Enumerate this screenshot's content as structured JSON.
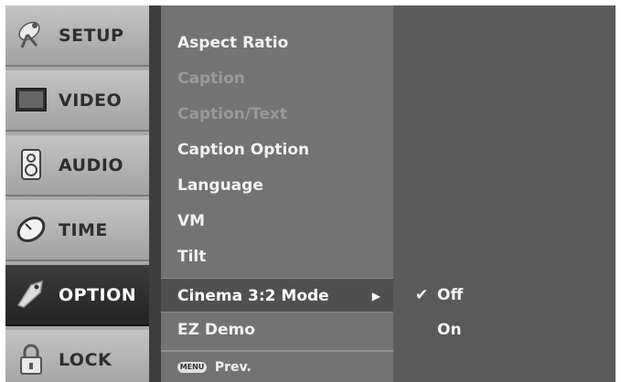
{
  "tabs": [
    {
      "label": "SETUP",
      "icon": "satellite-icon",
      "active": false
    },
    {
      "label": "VIDEO",
      "icon": "tv-icon",
      "active": false
    },
    {
      "label": "AUDIO",
      "icon": "speaker-icon",
      "active": false
    },
    {
      "label": "TIME",
      "icon": "clock-icon",
      "active": false
    },
    {
      "label": "OPTION",
      "icon": "tag-icon",
      "active": true
    },
    {
      "label": "LOCK",
      "icon": "padlock-icon",
      "active": false
    }
  ],
  "menu": {
    "items": [
      {
        "label": "Aspect Ratio",
        "enabled": true
      },
      {
        "label": "Caption",
        "enabled": false
      },
      {
        "label": "Caption/Text",
        "enabled": false
      },
      {
        "label": "Caption Option",
        "enabled": true
      },
      {
        "label": "Language",
        "enabled": true
      },
      {
        "label": "VM",
        "enabled": true
      },
      {
        "label": "Tilt",
        "enabled": true
      },
      {
        "label": "Cinema 3:2 Mode",
        "enabled": true,
        "selected": true
      },
      {
        "label": "EZ Demo",
        "enabled": true
      }
    ],
    "footer": {
      "key_label": "MENU",
      "label": "Prev."
    }
  },
  "submenu": {
    "options": [
      {
        "label": "Off",
        "checked": true
      },
      {
        "label": "On",
        "checked": false
      }
    ]
  }
}
